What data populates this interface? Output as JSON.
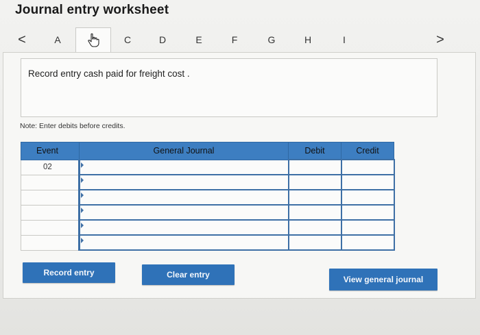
{
  "page_title": "Journal entry worksheet",
  "tabs": {
    "prev_arrow": "<",
    "next_arrow": ">",
    "items": [
      {
        "label": "A"
      },
      {
        "label": "",
        "active": true
      },
      {
        "label": "C"
      },
      {
        "label": "D"
      },
      {
        "label": "E"
      },
      {
        "label": "F"
      },
      {
        "label": "G"
      },
      {
        "label": "H"
      },
      {
        "label": "I"
      }
    ]
  },
  "prompt": "Record entry cash paid for freight cost .",
  "note": "Note: Enter debits before credits.",
  "table": {
    "headers": {
      "event": "Event",
      "general_journal": "General Journal",
      "debit": "Debit",
      "credit": "Credit"
    },
    "rows": [
      {
        "event": "02",
        "account": "",
        "debit": "",
        "credit": ""
      },
      {
        "event": "",
        "account": "",
        "debit": "",
        "credit": ""
      },
      {
        "event": "",
        "account": "",
        "debit": "",
        "credit": ""
      },
      {
        "event": "",
        "account": "",
        "debit": "",
        "credit": ""
      },
      {
        "event": "",
        "account": "",
        "debit": "",
        "credit": ""
      },
      {
        "event": "",
        "account": "",
        "debit": "",
        "credit": ""
      }
    ]
  },
  "buttons": {
    "record_entry": "Record entry",
    "clear_entry": "Clear entry",
    "view_general_journal": "View general journal"
  },
  "colors": {
    "header_blue": "#3d7ec1",
    "button_blue": "#2f72b8"
  }
}
